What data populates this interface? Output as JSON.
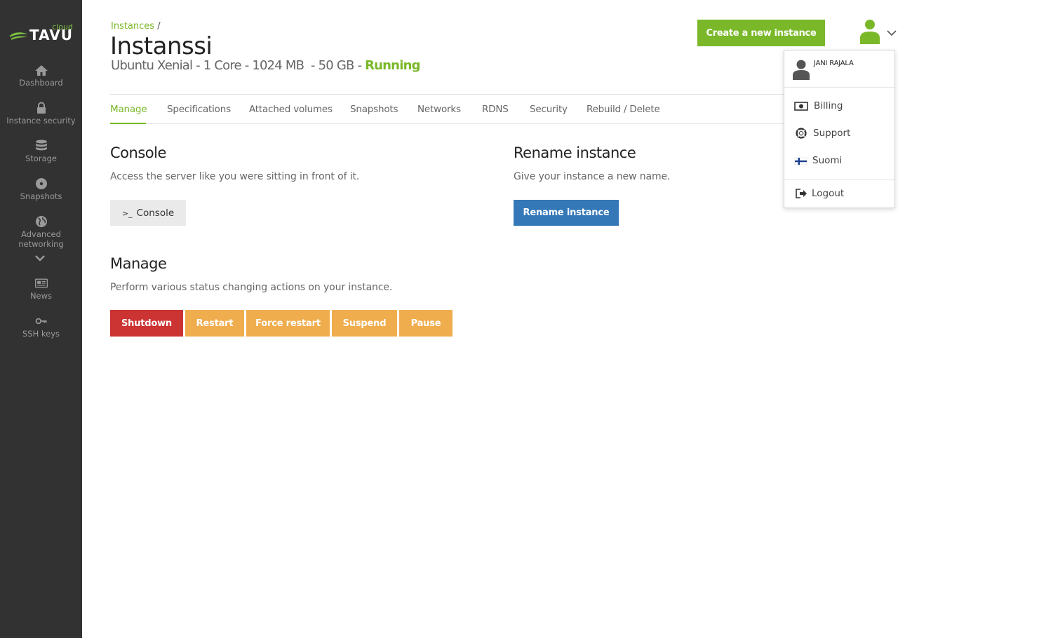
{
  "brand": {
    "name": "TAVU",
    "sub": "cloud"
  },
  "sidebar": {
    "items": [
      {
        "label": "Dashboard",
        "icon": "home-icon"
      },
      {
        "label": "Instance security",
        "icon": "lock-icon"
      },
      {
        "label": "Storage",
        "icon": "database-icon"
      },
      {
        "label": "Snapshots",
        "icon": "disc-icon"
      },
      {
        "label": "Advanced networking",
        "icon": "globe-icon"
      },
      {
        "label": "News",
        "icon": "newspaper-icon"
      },
      {
        "label": "SSH keys",
        "icon": "key-icon"
      }
    ]
  },
  "header": {
    "breadcrumb": "Instances",
    "breadcrumb_sep": "/",
    "title": "Instanssi",
    "subtitle": "Ubuntu Xenial - 1 Core - 1024 MB  - 50 GB - ",
    "status": "Running",
    "create_label": "Create a new instance"
  },
  "tabs": [
    {
      "label": "Manage",
      "active": true
    },
    {
      "label": "Specifications"
    },
    {
      "label": "Attached volumes"
    },
    {
      "label": "Snapshots"
    },
    {
      "label": "Networks"
    },
    {
      "label": "RDNS"
    },
    {
      "label": "Security"
    },
    {
      "label": "Rebuild / Delete"
    }
  ],
  "console": {
    "title": "Console",
    "desc": "Access the server like you were sitting in front of it.",
    "button": "Console",
    "button_glyph": ">_"
  },
  "rename": {
    "title": "Rename instance",
    "desc": "Give your instance a new name.",
    "button": "Rename instance"
  },
  "manage": {
    "title": "Manage",
    "desc": "Perform various status changing actions on your instance.",
    "buttons": [
      "Shutdown",
      "Restart",
      "Force restart",
      "Suspend",
      "Pause"
    ]
  },
  "user_menu": {
    "name": "JANI RAJALA",
    "items": [
      {
        "label": "Billing",
        "icon": "billing-icon"
      },
      {
        "label": "Support",
        "icon": "lifebuoy-icon"
      },
      {
        "label": "Suomi",
        "icon": "finland-flag-icon"
      },
      {
        "label": "Logout",
        "icon": "logout-icon"
      }
    ]
  },
  "colors": {
    "accent": "#7ab829",
    "primary": "#3478b8",
    "danger": "#cc3333",
    "warning": "#f0ad4e",
    "sidebar": "#323232"
  }
}
